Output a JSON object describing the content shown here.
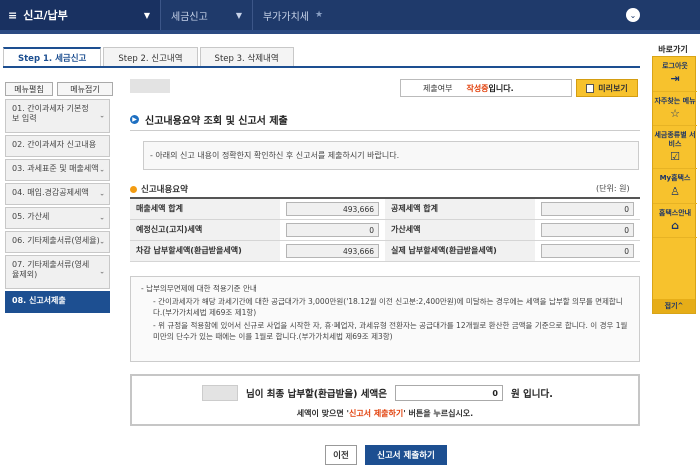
{
  "topnav": {
    "menu_label": "신고/납부",
    "breadcrumb1": "세금신고",
    "breadcrumb2": "부가가치세"
  },
  "tabs": [
    {
      "label": "Step 1. 세금신고"
    },
    {
      "label": "Step 2. 신고내역"
    },
    {
      "label": "Step 3. 삭제내역"
    }
  ],
  "sidebar": {
    "expand_label": "메뉴펼침",
    "collapse_label": "메뉴접기",
    "items": [
      {
        "label": "01. 간이과세자 기본정보 입력"
      },
      {
        "label": "02. 간이과세자 신고내용"
      },
      {
        "label": "03. 과세표준 및 매출세액"
      },
      {
        "label": "04. 매입.경감공제세액"
      },
      {
        "label": "05. 가산세"
      },
      {
        "label": "06. 기타제출서류(영세율)"
      },
      {
        "label": "07. 기타제출서류(영세율제외)"
      },
      {
        "label": "08. 신고서제출"
      }
    ]
  },
  "status": {
    "label": "제출여부",
    "value": "작성중",
    "suffix": "입니다."
  },
  "preview_label": "미리보기",
  "main": {
    "title": "신고내용요약 조회 및 신고서 제출",
    "info": "- 아래의 신고 내용이 정확한지 확인하신 후 신고서를 제출하시기 바랍니다.",
    "summary_title": "신고내용요약",
    "unit": "(단위: 원)",
    "rows": [
      {
        "l_label": "매출세액 합계",
        "l_value": "493,666",
        "r_label": "공제세액 합계",
        "r_value": "0"
      },
      {
        "l_label": "예정신고(고지)세액",
        "l_value": "0",
        "r_label": "가산세액",
        "r_value": "0"
      },
      {
        "l_label": "차감 납부할세액(환급받을세액)",
        "l_value": "493,666",
        "r_label": "실제 납부할세액(환급받을세액)",
        "r_value": "0"
      }
    ],
    "notes": {
      "heading": "- 납부의무면제에 대한 적용기준 안내",
      "line1": "- 간이과세자가 해당 과세기간에 대한 공급대가가 3,000만원('18.12월 이전 신고분:2,400만원)에 미달하는 경우에는 세액을 납부할 의무를 면제합니다.(부가가치세법 제69조 제1항)",
      "line2": "- 위 규정을 적용함에 있어서 신규로 사업을 시작한 자, 휴·폐업자, 과세유형 전환자는 공급대가를 12개월로 환산한 금액을 기준으로 합니다. 이 경우 1월 미만의 단수가 있는 때에는 이를 1월로 합니다.(부가가치세법 제69조 제3항)"
    },
    "final": {
      "text_a": "님이 최종 납부할(환급받을) 세액은",
      "amount": "0",
      "text_b": "원 입니다.",
      "msg_a": "세액이 맞으면 '",
      "msg_red": "신고서 제출하기",
      "msg_b": "' 버튼을 누르십시오."
    }
  },
  "buttons": {
    "prev": "이전",
    "submit": "신고서 제출하기"
  },
  "quick": {
    "title": "바로가기",
    "items": [
      {
        "label": "로그아웃",
        "icon": "logout-icon"
      },
      {
        "label": "자주찾는 메뉴",
        "icon": "star-icon"
      },
      {
        "label": "세금종류별 서비스",
        "icon": "check-icon"
      },
      {
        "label": "My홈택스",
        "icon": "person-icon"
      },
      {
        "label": "홈택스안내",
        "icon": "home-icon"
      }
    ],
    "fold_label": "접기^"
  }
}
